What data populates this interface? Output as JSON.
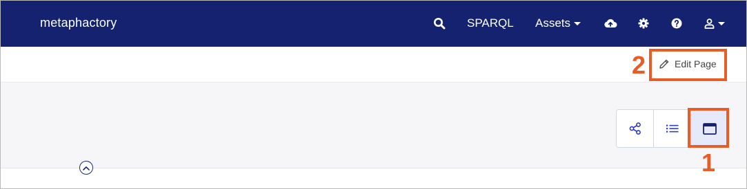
{
  "navbar": {
    "brand": "metaphactory",
    "sparql_label": "SPARQL",
    "assets_label": "Assets",
    "icons": [
      "search-icon",
      "cloud-upload-icon",
      "gear-icon",
      "help-icon",
      "user-icon"
    ]
  },
  "page_header": {
    "edit_label": "Edit Page"
  },
  "view_toggle": {
    "options": [
      "graph-view",
      "list-view",
      "page-view"
    ],
    "selected": "page-view"
  },
  "callouts": {
    "one": "1",
    "two": "2"
  },
  "colors": {
    "navbar_bg": "#14226f",
    "accent": "#2b39c8",
    "callout": "#e85c26",
    "content_bg": "#f6f6f8"
  }
}
